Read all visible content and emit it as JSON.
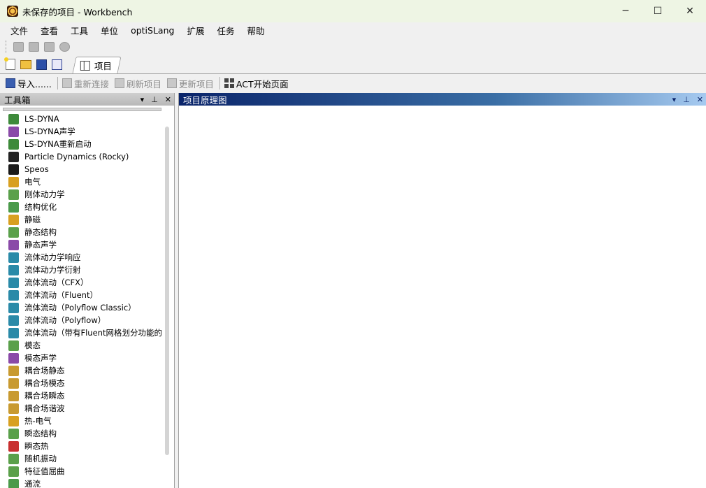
{
  "window": {
    "title": "未保存的项目 - Workbench",
    "controls": [
      "minimize",
      "maximize",
      "close"
    ]
  },
  "menu": [
    "文件",
    "查看",
    "工具",
    "单位",
    "optiSLang",
    "扩展",
    "任务",
    "帮助"
  ],
  "tab": {
    "label": "项目"
  },
  "toolbar3": {
    "import": "导入......",
    "reconnect": "重新连接",
    "refresh": "刷新项目",
    "update": "更新项目",
    "act": "ACT开始页面"
  },
  "toolbox": {
    "title": "工具箱",
    "items": [
      {
        "label": "LS-DYNA",
        "icon": "ls-dyna-icon",
        "color": "#3d8a3a"
      },
      {
        "label": "LS-DYNA声学",
        "icon": "acoustics-icon",
        "color": "#8a4aa8"
      },
      {
        "label": "LS-DYNA重新启动",
        "icon": "ls-dyna-restart-icon",
        "color": "#3d8a3a"
      },
      {
        "label": "Particle Dynamics (Rocky)",
        "icon": "rocky-icon",
        "color": "#222222"
      },
      {
        "label": "Speos",
        "icon": "speos-icon",
        "color": "#1a1a1a"
      },
      {
        "label": "电气",
        "icon": "electric-icon",
        "color": "#d8a020"
      },
      {
        "label": "刚体动力学",
        "icon": "rigid-dynamics-icon",
        "color": "#5aa04a"
      },
      {
        "label": "结构优化",
        "icon": "topology-icon",
        "color": "#4a9a4a"
      },
      {
        "label": "静磁",
        "icon": "magnetostatic-icon",
        "color": "#d8a020"
      },
      {
        "label": "静态结构",
        "icon": "static-structural-icon",
        "color": "#5aa04a"
      },
      {
        "label": "静态声学",
        "icon": "static-acoustics-icon",
        "color": "#8a4aa8"
      },
      {
        "label": "流体动力学响应",
        "icon": "hydrodynamic-response-icon",
        "color": "#2a8aa8"
      },
      {
        "label": "流体动力学衍射",
        "icon": "hydrodynamic-diffraction-icon",
        "color": "#2a8aa8"
      },
      {
        "label": "流体流动（CFX）",
        "icon": "cfx-icon",
        "color": "#2a8aa8"
      },
      {
        "label": "流体流动（Fluent）",
        "icon": "fluent-icon",
        "color": "#2a8aa8"
      },
      {
        "label": "流体流动（Polyflow Classic）",
        "icon": "polyflow-classic-icon",
        "color": "#2a8aa8"
      },
      {
        "label": "流体流动（Polyflow）",
        "icon": "polyflow-icon",
        "color": "#2a8aa8"
      },
      {
        "label": "流体流动（带有Fluent网格划分功能的",
        "icon": "fluent-meshing-icon",
        "color": "#2a8aa8"
      },
      {
        "label": "模态",
        "icon": "modal-icon",
        "color": "#5aa04a"
      },
      {
        "label": "模态声学",
        "icon": "modal-acoustics-icon",
        "color": "#8a4aa8"
      },
      {
        "label": "耦合场静态",
        "icon": "coupled-static-icon",
        "color": "#c89a30"
      },
      {
        "label": "耦合场模态",
        "icon": "coupled-modal-icon",
        "color": "#c89a30"
      },
      {
        "label": "耦合场瞬态",
        "icon": "coupled-transient-icon",
        "color": "#c89a30"
      },
      {
        "label": "耦合场谐波",
        "icon": "coupled-harmonic-icon",
        "color": "#c89a30"
      },
      {
        "label": "热-电气",
        "icon": "thermal-electric-icon",
        "color": "#d8a020"
      },
      {
        "label": "瞬态结构",
        "icon": "transient-structural-icon",
        "color": "#5aa04a"
      },
      {
        "label": "瞬态热",
        "icon": "transient-thermal-icon",
        "color": "#c83030"
      },
      {
        "label": "随机振动",
        "icon": "random-vibration-icon",
        "color": "#5aa04a"
      },
      {
        "label": "特征值屈曲",
        "icon": "eigenvalue-buckling-icon",
        "color": "#5aa04a"
      },
      {
        "label": "通流",
        "icon": "throughflow-icon",
        "color": "#4a9a4a"
      }
    ]
  },
  "schematic": {
    "title": "项目原理图"
  }
}
